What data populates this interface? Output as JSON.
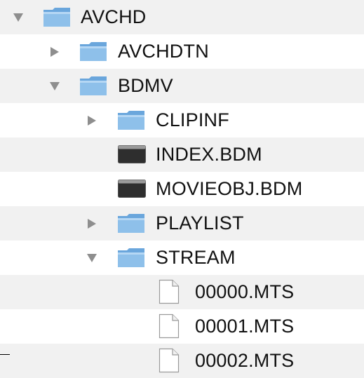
{
  "colors": {
    "folder": "#7fb4e3",
    "folder_tab": "#9fc9ee",
    "disclosure": "#8e8e8e",
    "row_alt": "#f1f1f1"
  },
  "rows": [
    {
      "label": "AVCHD",
      "icon": "folder-icon",
      "disclosure": "expanded"
    },
    {
      "label": "AVCHDTN",
      "icon": "folder-icon",
      "disclosure": "collapsed"
    },
    {
      "label": "BDMV",
      "icon": "folder-icon",
      "disclosure": "expanded"
    },
    {
      "label": "CLIPINF",
      "icon": "folder-icon",
      "disclosure": "collapsed"
    },
    {
      "label": "INDEX.BDM",
      "icon": "exec-file-icon",
      "disclosure": "none"
    },
    {
      "label": "MOVIEOBJ.BDM",
      "icon": "exec-file-icon",
      "disclosure": "none"
    },
    {
      "label": "PLAYLIST",
      "icon": "folder-icon",
      "disclosure": "collapsed"
    },
    {
      "label": "STREAM",
      "icon": "folder-icon",
      "disclosure": "expanded"
    },
    {
      "label": "00000.MTS",
      "icon": "document-icon",
      "disclosure": "none"
    },
    {
      "label": "00001.MTS",
      "icon": "document-icon",
      "disclosure": "none"
    },
    {
      "label": "00002.MTS",
      "icon": "document-icon",
      "disclosure": "none"
    }
  ]
}
